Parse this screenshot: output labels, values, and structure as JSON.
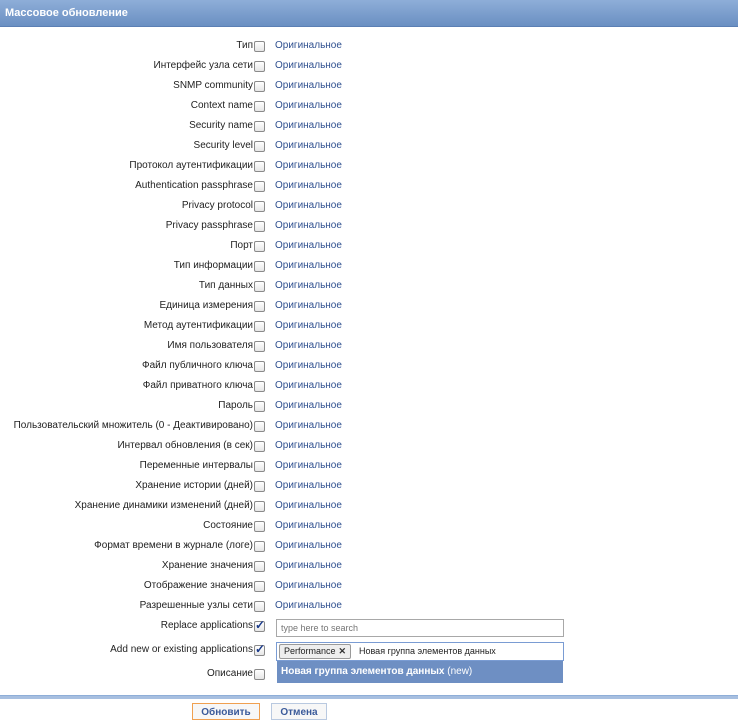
{
  "window": {
    "title": "Массовое обновление"
  },
  "rows": [
    {
      "label": "Тип",
      "value": "Оригинальное",
      "checked": false
    },
    {
      "label": "Интерфейс узла сети",
      "value": "Оригинальное",
      "checked": false
    },
    {
      "label": "SNMP community",
      "value": "Оригинальное",
      "checked": false
    },
    {
      "label": "Context name",
      "value": "Оригинальное",
      "checked": false
    },
    {
      "label": "Security name",
      "value": "Оригинальное",
      "checked": false
    },
    {
      "label": "Security level",
      "value": "Оригинальное",
      "checked": false
    },
    {
      "label": "Протокол аутентификации",
      "value": "Оригинальное",
      "checked": false
    },
    {
      "label": "Authentication passphrase",
      "value": "Оригинальное",
      "checked": false
    },
    {
      "label": "Privacy protocol",
      "value": "Оригинальное",
      "checked": false
    },
    {
      "label": "Privacy passphrase",
      "value": "Оригинальное",
      "checked": false
    },
    {
      "label": "Порт",
      "value": "Оригинальное",
      "checked": false
    },
    {
      "label": "Тип информации",
      "value": "Оригинальное",
      "checked": false
    },
    {
      "label": "Тип данных",
      "value": "Оригинальное",
      "checked": false
    },
    {
      "label": "Единица измерения",
      "value": "Оригинальное",
      "checked": false
    },
    {
      "label": "Метод аутентификации",
      "value": "Оригинальное",
      "checked": false
    },
    {
      "label": "Имя пользователя",
      "value": "Оригинальное",
      "checked": false
    },
    {
      "label": "Файл публичного ключа",
      "value": "Оригинальное",
      "checked": false
    },
    {
      "label": "Файл приватного ключа",
      "value": "Оригинальное",
      "checked": false
    },
    {
      "label": "Пароль",
      "value": "Оригинальное",
      "checked": false
    },
    {
      "label": "Пользовательский множитель (0 - Деактивировано)",
      "value": "Оригинальное",
      "checked": false
    },
    {
      "label": "Интервал обновления (в сек)",
      "value": "Оригинальное",
      "checked": false
    },
    {
      "label": "Переменные интервалы",
      "value": "Оригинальное",
      "checked": false
    },
    {
      "label": "Хранение истории (дней)",
      "value": "Оригинальное",
      "checked": false
    },
    {
      "label": "Хранение динамики изменений (дней)",
      "value": "Оригинальное",
      "checked": false
    },
    {
      "label": "Состояние",
      "value": "Оригинальное",
      "checked": false
    },
    {
      "label": "Формат времени в журнале (логе)",
      "value": "Оригинальное",
      "checked": false
    },
    {
      "label": "Хранение значения",
      "value": "Оригинальное",
      "checked": false
    },
    {
      "label": "Отображение значения",
      "value": "Оригинальное",
      "checked": false
    },
    {
      "label": "Разрешенные узлы сети",
      "value": "Оригинальное",
      "checked": false
    }
  ],
  "replace_applications": {
    "label": "Replace applications",
    "checked": true,
    "placeholder": "type here to search"
  },
  "add_applications": {
    "label": "Add new or existing applications",
    "checked": true,
    "tag": "Performance",
    "typed": "Новая группа элементов данных",
    "suggestion": "Новая группа элементов данных",
    "suggestion_suffix": "(new)"
  },
  "description": {
    "label": "Описание",
    "checked": false
  },
  "buttons": {
    "update": "Обновить",
    "cancel": "Отмена"
  },
  "colors": {
    "header": "#7b9bcb",
    "link": "#2e4f8f",
    "suggest_bg": "#6e8fc3"
  }
}
